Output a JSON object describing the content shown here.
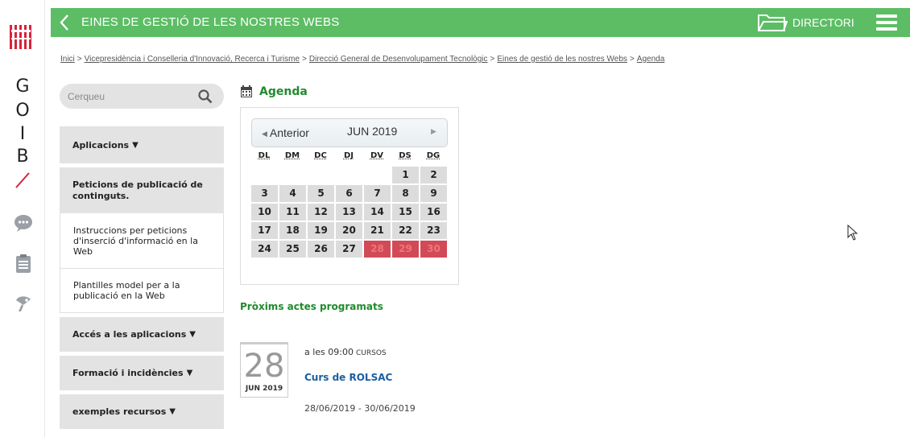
{
  "brand": {
    "letters": [
      "G",
      "O",
      "I",
      "B"
    ],
    "accent_color": "#d9213a"
  },
  "topbar": {
    "title": "EINES DE GESTIÓ DE LES NOSTRES WEBS",
    "directory_label": "DIRECTORI",
    "bar_color": "#5cbd65"
  },
  "breadcrumb": [
    "Inici",
    "Vicepresidència i Conselleria d'Innovació, Recerca i Turisme",
    "Direcció General de Desenvolupament Tecnològic",
    "Eines de gestió de les nostres Webs",
    "Agenda"
  ],
  "search": {
    "placeholder": "Cerqueu"
  },
  "side_menu": {
    "applications": "Aplicacions",
    "publication_requests": "Peticions de publicació de continguts.",
    "sub_instructions": "Instruccions per peticions d'inserció d'informació en la Web",
    "sub_templates": "Plantilles model per a la publicació en la Web",
    "access_apps": "Accés a les aplicacions",
    "training": "Formació i incidències",
    "examples": "exemples recursos"
  },
  "agenda": {
    "title": "Agenda",
    "calendar": {
      "prev_label": "Anterior",
      "month_label": "JUN 2019",
      "weekdays": [
        "DL",
        "DM",
        "DC",
        "DJ",
        "DV",
        "DS",
        "DG"
      ],
      "first_weekday_index": 5,
      "days_in_month": 30,
      "event_days": [
        28,
        29,
        30
      ],
      "event_color": "#d24a57"
    },
    "upcoming_title": "Pròxims actes programats",
    "event": {
      "day": "28",
      "month_year": "JUN 2019",
      "time": "a les 09:00",
      "category": "CURSOS",
      "title": "Curs de ROLSAC",
      "range": "28/06/2019 - 30/06/2019"
    }
  }
}
